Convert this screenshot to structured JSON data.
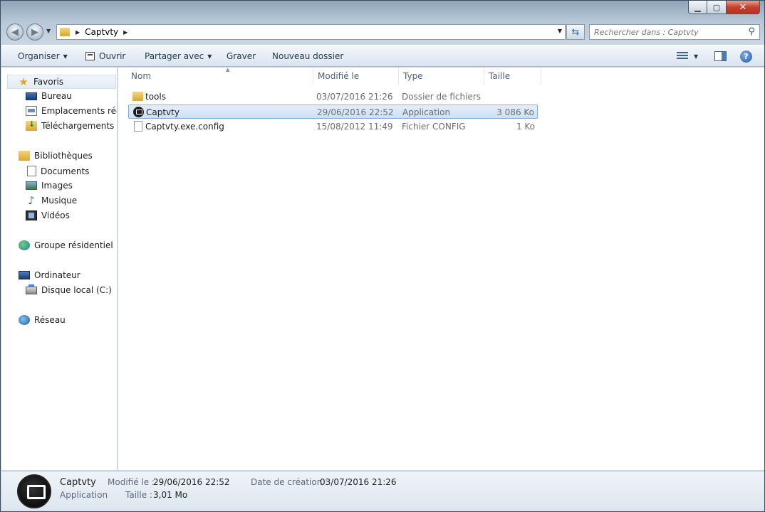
{
  "window": {
    "caption": {
      "minimize": "▁",
      "maximize": "▢",
      "close": "✕"
    }
  },
  "address": {
    "path": [
      "Captvty"
    ]
  },
  "search": {
    "placeholder": "Rechercher dans : Captvty"
  },
  "toolbar": {
    "organize": "Organiser",
    "open": "Ouvrir",
    "share": "Partager avec",
    "burn": "Graver",
    "new_folder": "Nouveau dossier"
  },
  "nav": {
    "favorites": "Favoris",
    "desktop": "Bureau",
    "recent_places": "Emplacements récer",
    "downloads": "Téléchargements",
    "libraries": "Bibliothèques",
    "documents": "Documents",
    "images": "Images",
    "music": "Musique",
    "videos": "Vidéos",
    "homegroup": "Groupe résidentiel",
    "computer": "Ordinateur",
    "local_disk": "Disque local (C:)",
    "network": "Réseau"
  },
  "columns": {
    "name": "Nom",
    "modified": "Modifié le",
    "type": "Type",
    "size": "Taille"
  },
  "files": [
    {
      "name": "tools",
      "modified": "03/07/2016 21:26",
      "type": "Dossier de fichiers",
      "size": "",
      "icon": "folder-icon"
    },
    {
      "name": "Captvty",
      "modified": "29/06/2016 22:52",
      "type": "Application",
      "size": "3 086 Ko",
      "icon": "application-icon",
      "selected": true
    },
    {
      "name": "Captvty.exe.config",
      "modified": "15/08/2012 11:49",
      "type": "Fichier CONFIG",
      "size": "1 Ko",
      "icon": "config-file-icon"
    }
  ],
  "details": {
    "name": "Captvty",
    "kind": "Application",
    "modified_label": "Modifié le :",
    "modified_value": "29/06/2016 22:52",
    "size_label": "Taille :",
    "size_value": "3,01 Mo",
    "created_label": "Date de création :",
    "created_value": "03/07/2016 21:26"
  }
}
